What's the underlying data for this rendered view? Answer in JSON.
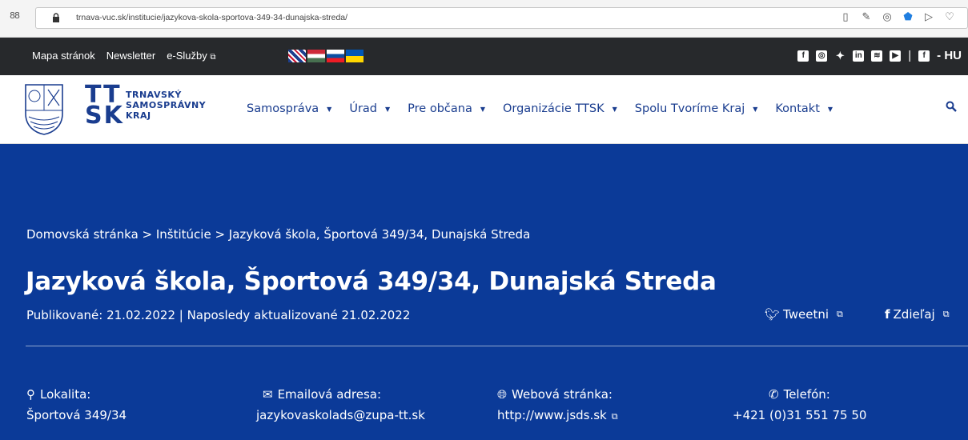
{
  "browser": {
    "url": "trnava-vuc.sk/institucie/jazykova-skola-sportova-349-34-dunajska-streda/"
  },
  "topbar": {
    "links": [
      "Mapa stránok",
      "Newsletter",
      "e-Služby"
    ],
    "lang_label": "- HU"
  },
  "logo": {
    "line1": "TRNAVSKÝ",
    "line2": "SAMOSPRÁVNY",
    "line3": "KRAJ",
    "mark_top": "TT",
    "mark_bottom": "SK"
  },
  "nav": {
    "items": [
      "Samospráva",
      "Úrad",
      "Pre občana",
      "Organizácie TTSK",
      "Spolu Tvoríme Kraj",
      "Kontakt"
    ]
  },
  "page": {
    "breadcrumb": "Domovská stránka > Inštitúcie > Jazyková škola, Športová 349/34, Dunajská Streda",
    "title": "Jazyková škola, Športová 349/34, Dunajská Streda",
    "meta": "Publikované: 21.02.2022 | Naposledy aktualizované 21.02.2022",
    "share_tweet": "Tweetni",
    "share_fb": "Zdieľaj"
  },
  "info": {
    "location_label": "Lokalita:",
    "location_value": "Športová 349/34",
    "email_label": "Emailová adresa:",
    "email_value": "jazykovaskolads@zupa-tt.sk",
    "web_label": "Webová stránka:",
    "web_value": "http://www.jsds.sk",
    "phone_label": "Telefón:",
    "phone_value": "+421 (0)31 551 75 50"
  },
  "colors": {
    "hero_blue": "#0b3a98",
    "brand_blue": "#1a3d8f",
    "topbar_dark": "#27292c"
  }
}
